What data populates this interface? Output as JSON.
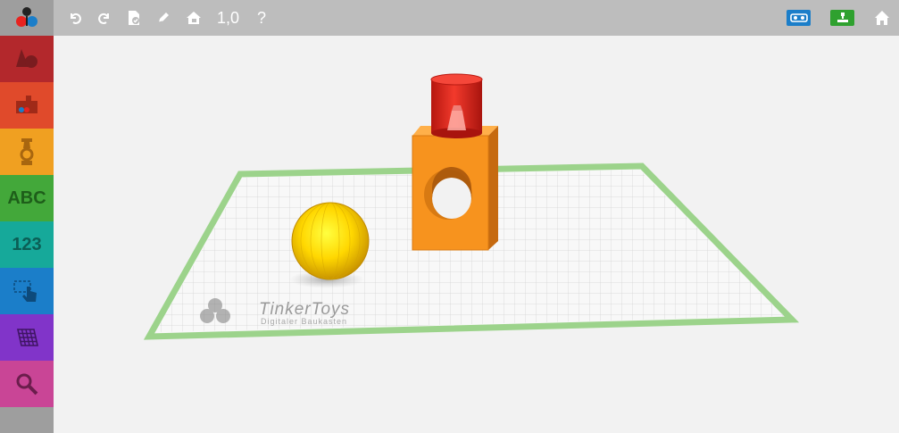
{
  "toolbar": {
    "zoom_value": "1,0",
    "help_label": "?"
  },
  "sidebar": {
    "items": [
      {
        "name": "shapes",
        "label": "",
        "color": "#b3282c"
      },
      {
        "name": "parts",
        "label": "",
        "color": "#e04a2b"
      },
      {
        "name": "figures",
        "label": "",
        "color": "#f0a021"
      },
      {
        "name": "text",
        "label": "ABC",
        "color": "#43a83a"
      },
      {
        "name": "numbers",
        "label": "123",
        "color": "#16a99a"
      },
      {
        "name": "select",
        "label": "",
        "color": "#1b7ec9"
      },
      {
        "name": "grid",
        "label": "",
        "color": "#8134c9"
      },
      {
        "name": "zoom",
        "label": "",
        "color": "#c94596"
      }
    ]
  },
  "canvas": {
    "plate_brand": "TinkerToys",
    "plate_tagline": "Digitaler Baukasten"
  },
  "colors": {
    "vr_badge": "#1b7ec9",
    "print_badge": "#2fa12f",
    "plate_border": "#9cd38b",
    "sphere": "#ffd700",
    "block": "#f7931e",
    "cylinder": "#e8231f"
  }
}
